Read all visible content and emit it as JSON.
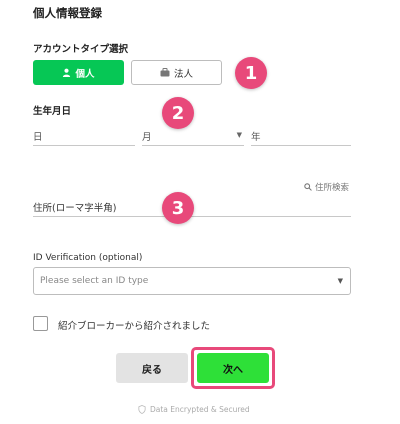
{
  "page": {
    "title": "個人情報登録"
  },
  "account_type": {
    "label": "アカウントタイプ選択",
    "personal_label": "個人",
    "corporate_label": "法人"
  },
  "badges": [
    "1",
    "2",
    "3"
  ],
  "birthdate": {
    "label": "生年月日",
    "day_placeholder": "日",
    "month_placeholder": "月",
    "year_placeholder": "年"
  },
  "address": {
    "search_link": "住所検索",
    "placeholder": "住所(ローマ字半角)"
  },
  "id_verification": {
    "label": "ID Verification (optional)",
    "placeholder": "Please select an ID type"
  },
  "broker": {
    "label": "紹介ブローカーから紹介されました"
  },
  "actions": {
    "back_label": "戻る",
    "next_label": "次へ"
  },
  "footer": {
    "secure_note": "Data Encrypted & Secured"
  },
  "colors": {
    "primary_green": "#06c755",
    "next_green": "#2ee038",
    "badge_pink": "#e8497a"
  }
}
